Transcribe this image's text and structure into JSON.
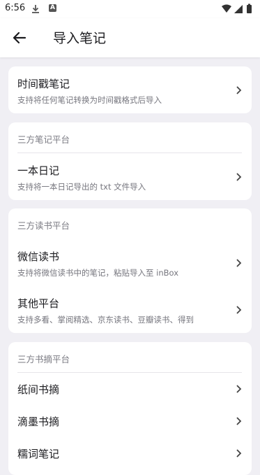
{
  "status": {
    "time": "6:56"
  },
  "appbar": {
    "title": "导入笔记"
  },
  "timestamp_card": {
    "title": "时间戳笔记",
    "subtitle": "支持将任何笔记转换为时间戳格式后导入"
  },
  "note_platforms": {
    "section_title": "三方笔记平台",
    "items": [
      {
        "title": "一本日记",
        "subtitle": "支持将一本日记导出的 txt 文件导入"
      }
    ]
  },
  "reading_platforms": {
    "section_title": "三方读书平台",
    "items": [
      {
        "title": "微信读书",
        "subtitle": "支持将微信读书中的笔记，粘贴导入至 inBox"
      },
      {
        "title": "其他平台",
        "subtitle": "支持多看、掌阅精选、京东读书、豆瓣读书、得到"
      }
    ]
  },
  "excerpt_platforms": {
    "section_title": "三方书摘平台",
    "items": [
      {
        "title": "纸间书摘"
      },
      {
        "title": "滴墨书摘"
      },
      {
        "title": "糯词笔记"
      }
    ]
  }
}
